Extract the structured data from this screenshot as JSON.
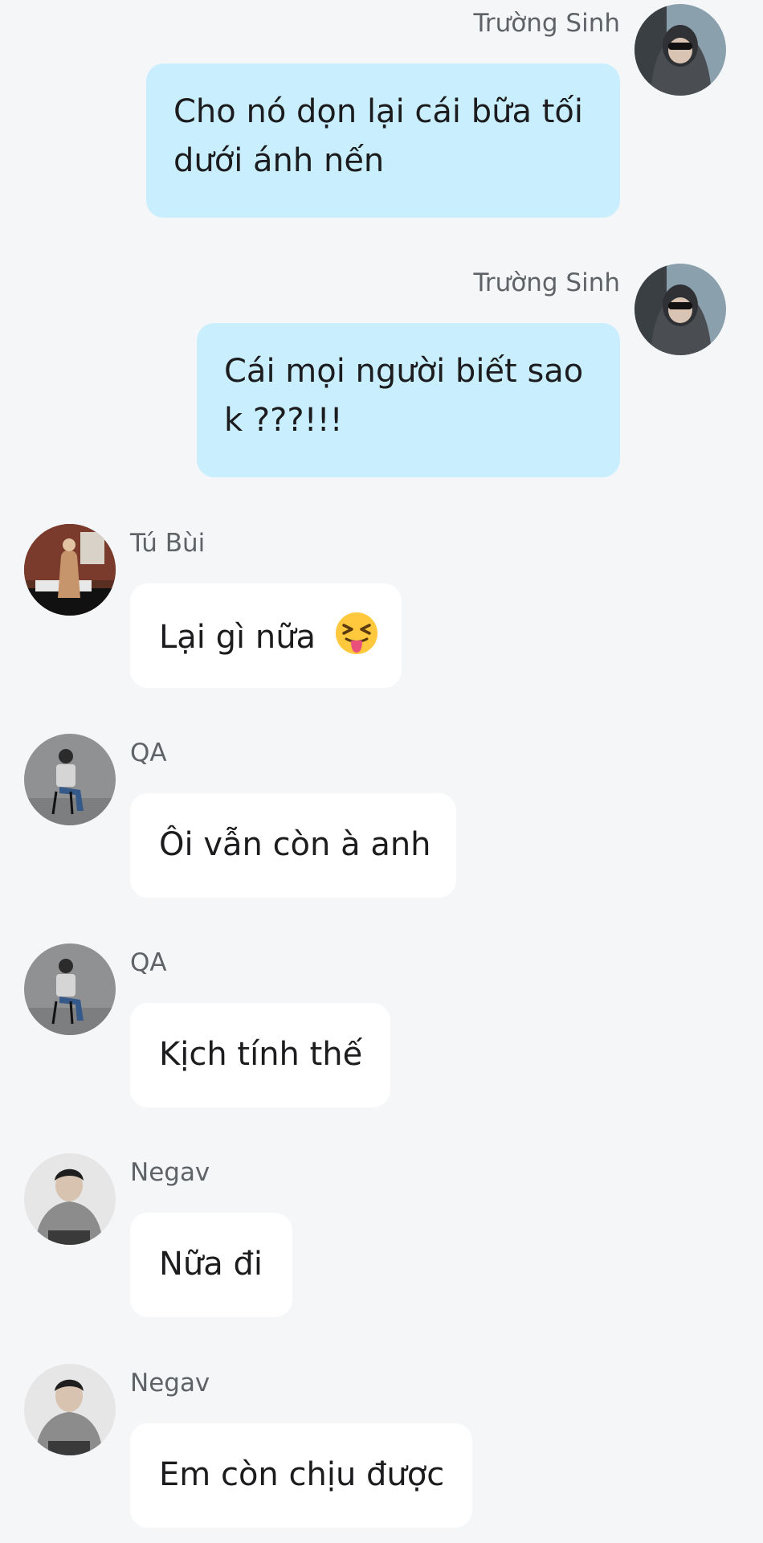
{
  "messages": [
    {
      "sender": "Trường Sinh",
      "text": "Cho nó dọn lại cái bữa tối dưới ánh nến",
      "avatar": "avatar-truong-sinh"
    },
    {
      "sender": "Trường Sinh",
      "text": "Cái mọi người biết sao k ???!!!",
      "avatar": "avatar-truong-sinh"
    },
    {
      "sender": "Tú Bùi",
      "text": "Lại gì nữa",
      "emoji": "squinting-face-with-tongue-icon",
      "avatar": "avatar-tu-bui"
    },
    {
      "sender": "QA",
      "text": "Ôi vẫn còn à anh",
      "avatar": "avatar-qa"
    },
    {
      "sender": "QA",
      "text": "Kịch tính thế",
      "avatar": "avatar-qa"
    },
    {
      "sender": "Negav",
      "text": "Nữa đi",
      "avatar": "avatar-negav"
    },
    {
      "sender": "Negav",
      "text": "Em còn chịu được",
      "avatar": "avatar-negav"
    }
  ],
  "colors": {
    "background": "#f5f6f8",
    "outgoing_bubble": "#c9efff",
    "incoming_bubble": "#ffffff",
    "sender_text": "#5f6368"
  }
}
